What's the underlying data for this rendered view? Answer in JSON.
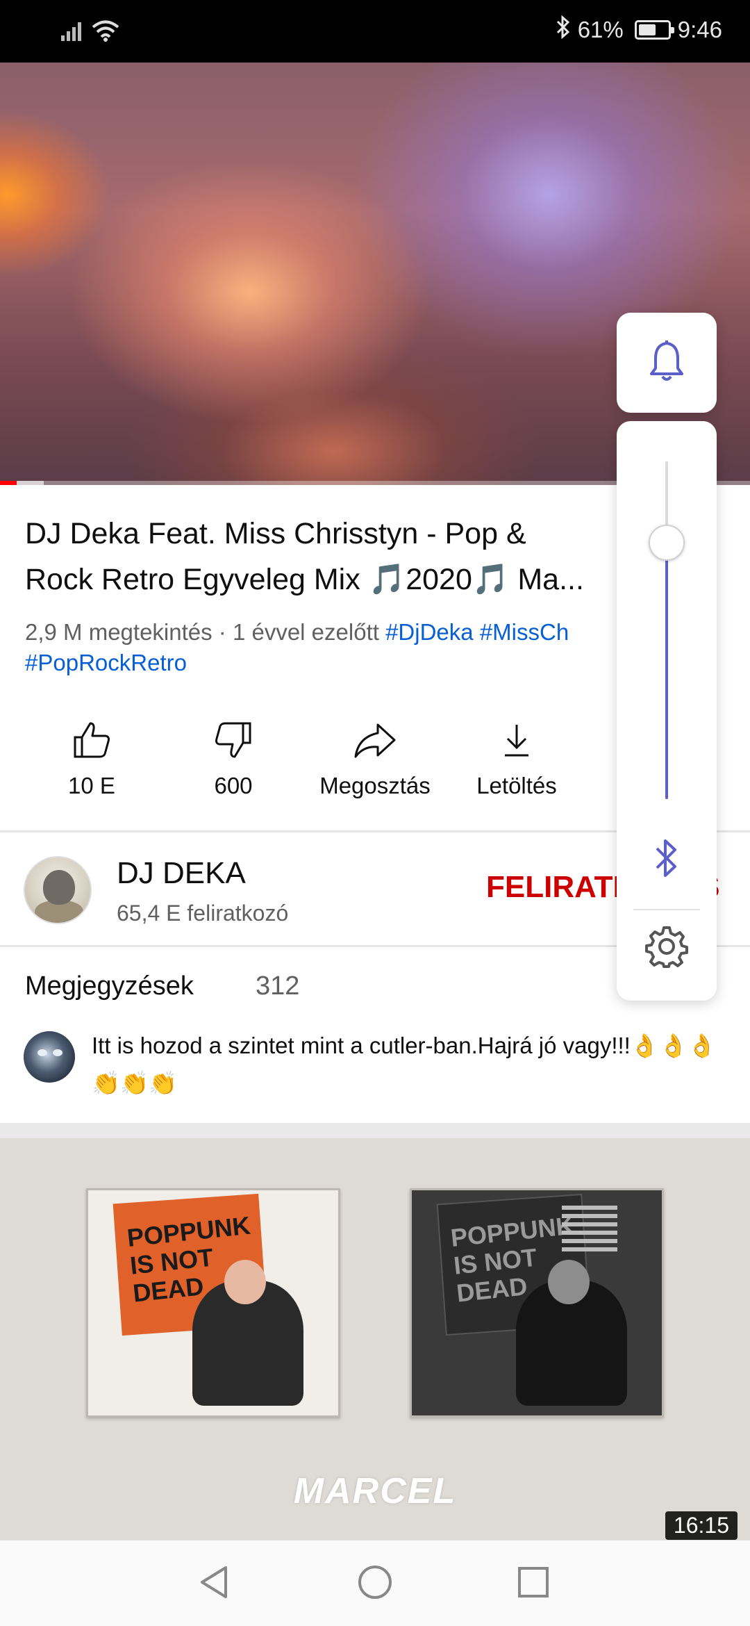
{
  "status_bar": {
    "battery_percent": "61%",
    "battery_level": 0.61,
    "time": "9:46",
    "icons": [
      "signal-icon",
      "wifi-icon",
      "bluetooth-icon",
      "battery-icon"
    ]
  },
  "video": {
    "played_fraction": 0.022,
    "buffered_fraction": 0.058,
    "progress_color": "#ff0000"
  },
  "title": {
    "line1": "DJ Deka Feat. Miss Chrisstyn - Pop &",
    "line2": "Rock Retro Egyveleg Mix 🎵2020🎵 Ma..."
  },
  "meta": {
    "views_and_age": "2,9 M megtekintés · 1 évvel ezelőtt",
    "hashtag1": "#DjDeka",
    "hashtag2": "#MissCh",
    "hashtag3": "#PopRockRetro",
    "link_color": "#065fd4"
  },
  "actions": {
    "like": {
      "icon": "thumbs-up-icon",
      "label": "10 E"
    },
    "dislike": {
      "icon": "thumbs-down-icon",
      "label": "600"
    },
    "share": {
      "icon": "share-icon",
      "label": "Megosztás"
    },
    "download": {
      "icon": "download-icon",
      "label": "Letöltés"
    }
  },
  "channel": {
    "name": "DJ DEKA",
    "subscribers": "65,4 E feliratkozó",
    "subscribe_label": "FELIRATKOZÁS",
    "subscribe_color": "#cc0000"
  },
  "comments": {
    "title": "Megjegyzések",
    "count": "312",
    "top_comment": "Itt is hozod a szintet mint a cutler-ban.Hajrá jó vagy!!!👌👌👌👏👏👏"
  },
  "next_video": {
    "brand_text": "MARCEL",
    "flag_text": "POPPUNK IS NOT DEAD",
    "duration": "16:15"
  },
  "volume_panel": {
    "level": 0.76,
    "accent_color": "#5b5fc7",
    "icons": [
      "bell-icon",
      "bluetooth-icon",
      "gear-icon"
    ]
  },
  "navbar": {
    "icons": [
      "back-icon",
      "home-icon",
      "recents-icon"
    ]
  }
}
